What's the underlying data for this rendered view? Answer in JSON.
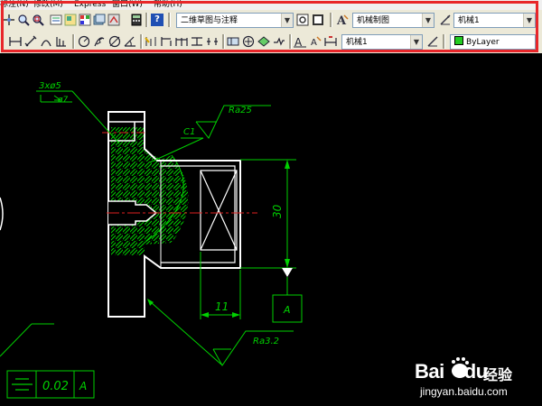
{
  "menu": [
    "标注(N)",
    "修改(M)",
    "Express",
    "窗口(W)",
    "帮助(H)"
  ],
  "toolbar1": {
    "workspace": "二维草图与注释",
    "text_style": "机械制图",
    "dim_style": "机械1",
    "help_icon": "help-question-icon"
  },
  "toolbar2": {
    "dim_style": "机械1",
    "layer": "ByLayer",
    "layer_color": "#22cc22"
  },
  "drawing": {
    "hole_note_1": "3xø5",
    "hole_note_2": "ø7",
    "chamfer": "C1",
    "roughness_top": "Ra25",
    "roughness_bottom": "Ra3.2",
    "dim_vertical": "30",
    "dim_horizontal": "11",
    "datum": "A",
    "tolerance_value": "0.02",
    "tolerance_datum": "A",
    "colors": {
      "outline": "#ffffff",
      "dims": "#00d000",
      "hatch": "#00d000",
      "center": "#e02020"
    }
  },
  "watermark": {
    "brand": "Bai",
    "brand_mid": "du",
    "cn": "经验",
    "url": "jingyan.baidu.com"
  }
}
